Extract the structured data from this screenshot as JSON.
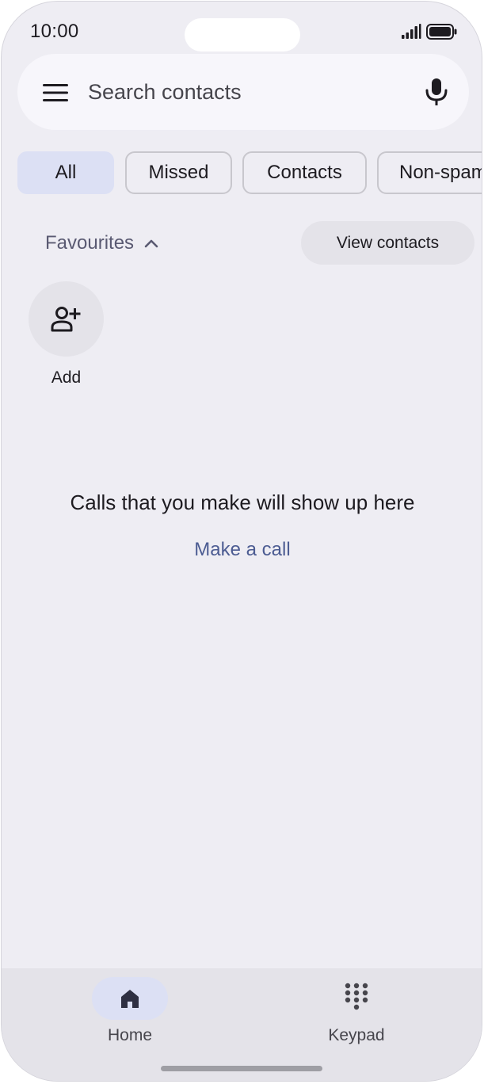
{
  "status_bar": {
    "time": "10:00",
    "signal_icon": "signal-icon",
    "battery_icon": "battery-icon"
  },
  "search": {
    "placeholder": "Search contacts",
    "menu_icon": "menu-icon",
    "mic_icon": "mic-icon"
  },
  "filters": [
    {
      "label": "All",
      "selected": true
    },
    {
      "label": "Missed",
      "selected": false
    },
    {
      "label": "Contacts",
      "selected": false
    },
    {
      "label": "Non-spam",
      "selected": false
    }
  ],
  "favourites": {
    "label": "Favourites",
    "chevron_icon": "chevron-up-icon",
    "view_contacts_label": "View contacts",
    "add_label": "Add",
    "add_icon": "add-person-icon"
  },
  "empty_state": {
    "message": "Calls that you make will show up here",
    "action_label": "Make a call"
  },
  "bottom_nav": {
    "items": [
      {
        "label": "Home",
        "icon": "home-icon",
        "active": true
      },
      {
        "label": "Keypad",
        "icon": "keypad-icon",
        "active": false
      }
    ]
  },
  "colors": {
    "background": "#eeedf3",
    "selected_chip": "#dce0f4",
    "link": "#4c5c92",
    "surface": "#e4e3e9"
  }
}
